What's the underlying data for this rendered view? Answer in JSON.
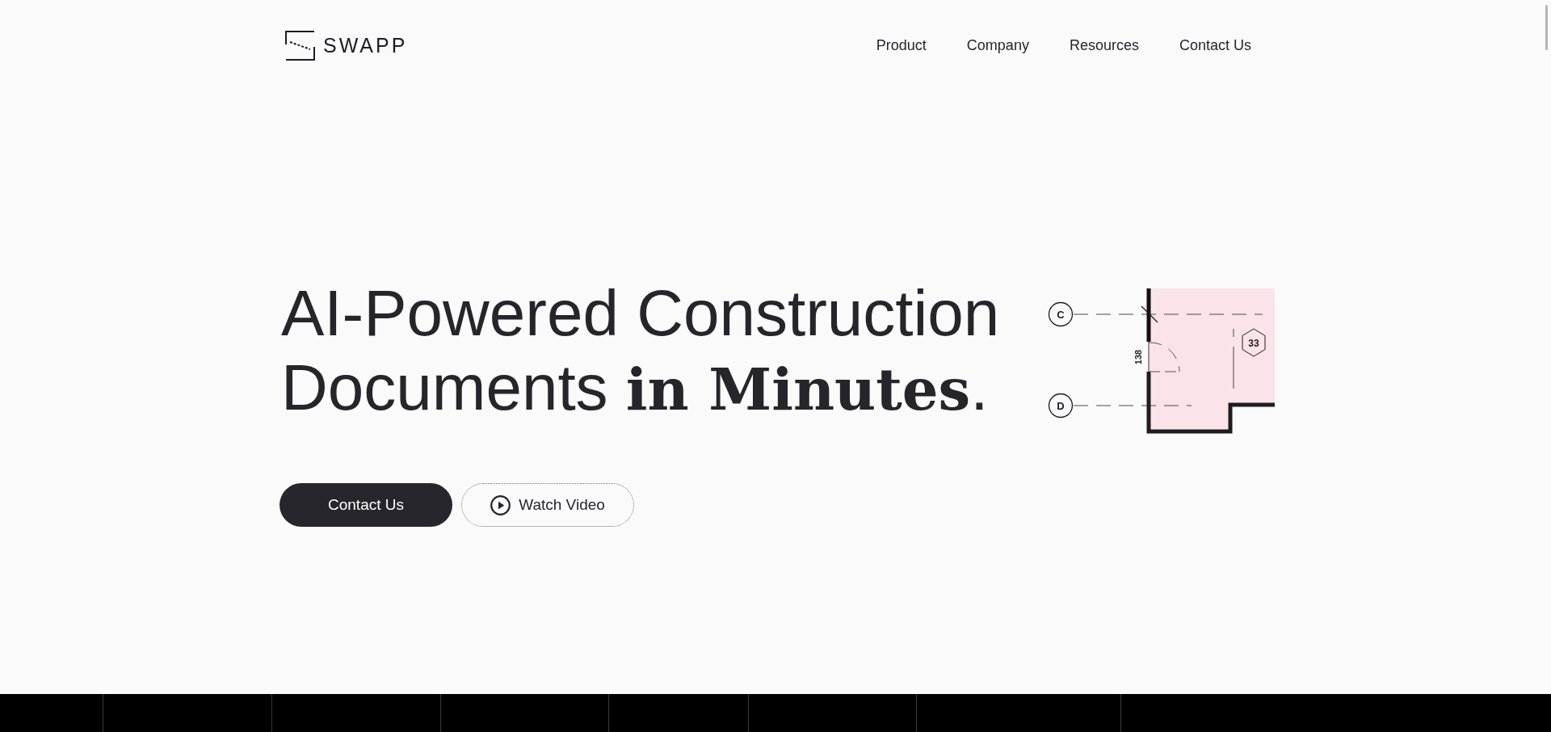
{
  "logo": {
    "text": "SWAPP"
  },
  "nav": [
    {
      "label": "Product"
    },
    {
      "label": "Company"
    },
    {
      "label": "Resources"
    },
    {
      "label": "Contact Us"
    }
  ],
  "hero": {
    "title_lines": [
      "AI-Powered Construction",
      "Documents **in Minutes**."
    ],
    "buttons": [
      {
        "label": "Contact Us",
        "kind": "primary"
      },
      {
        "label": "Watch Video",
        "kind": "video"
      }
    ]
  },
  "floor_plan": {
    "grid_lines": [
      {
        "label": "C"
      },
      {
        "label": "D"
      }
    ],
    "dimension": "138",
    "room_tag": "33"
  }
}
